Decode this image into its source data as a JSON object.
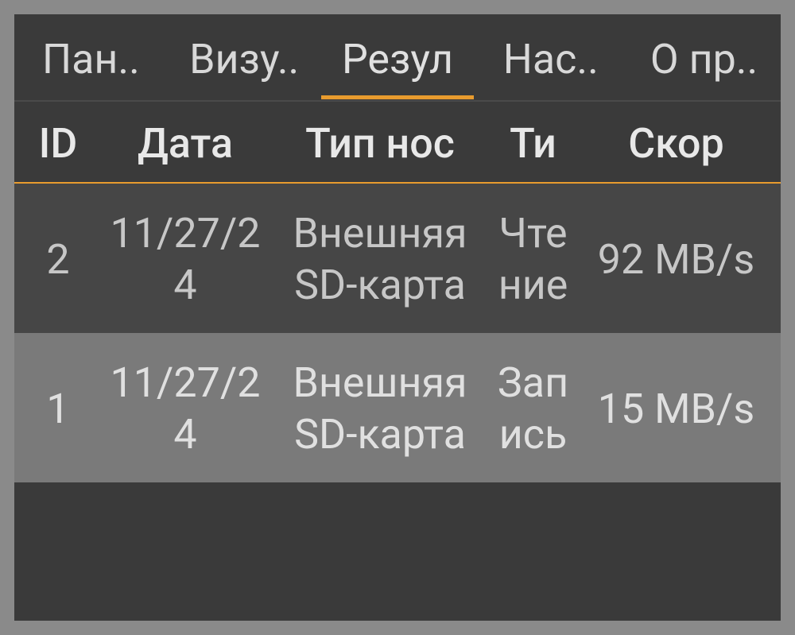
{
  "tabs": [
    {
      "label": "Пан..",
      "active": false
    },
    {
      "label": "Визу..",
      "active": false
    },
    {
      "label": "Резул",
      "active": true
    },
    {
      "label": "Нас..",
      "active": false
    },
    {
      "label": "О пр..",
      "active": false
    }
  ],
  "columns": {
    "id": "ID",
    "date": "Дата",
    "type": "Тип нос",
    "op": "Ти",
    "speed": "Скор"
  },
  "rows": [
    {
      "id": "2",
      "date": "11/27/24",
      "type": "Внешняя SD-карта",
      "op": "Чтение",
      "speed": "92 MB/s"
    },
    {
      "id": "1",
      "date": "11/27/24",
      "type": "Внешняя SD-карта",
      "op": "Запись",
      "speed": "15 MB/s"
    }
  ]
}
